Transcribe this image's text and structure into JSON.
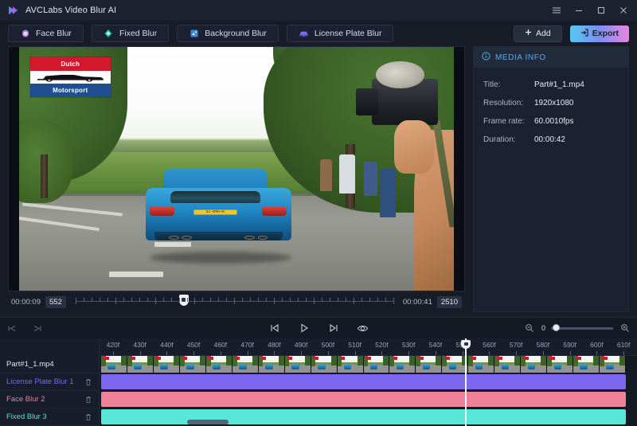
{
  "window": {
    "title": "AVCLabs Video Blur AI",
    "logo_icon": "play-chevron-logo-icon",
    "menu_icon": "hamburger-menu-icon",
    "minimize_icon": "minimize-icon",
    "maximize_icon": "maximize-icon",
    "close_icon": "close-icon"
  },
  "tabs": [
    {
      "label": "Face Blur",
      "icon": "face-blur-icon",
      "color": "#c58ae8"
    },
    {
      "label": "Fixed Blur",
      "icon": "fixed-blur-icon",
      "color": "#2fd6ac"
    },
    {
      "label": "Background Blur",
      "icon": "background-blur-icon",
      "color": "#4b9bf0"
    },
    {
      "label": "License Plate Blur",
      "icon": "license-plate-blur-icon",
      "color": "#7d6df0"
    }
  ],
  "header_buttons": {
    "add_label": "Add",
    "add_icon": "plus-icon",
    "export_label": "Export",
    "export_icon": "export-icon",
    "export_gradient_from": "#55c9f0",
    "export_gradient_to": "#e884de"
  },
  "preview": {
    "watermark": {
      "top_text": "Dutch",
      "bottom_text": "Motorsport",
      "car_icon": "race-car-silhouette-icon"
    },
    "license_plate_text": "ST-840-R"
  },
  "scrubber": {
    "start_time": "00:00:09",
    "start_frame": "552",
    "end_time": "00:00:41",
    "end_frame": "2510",
    "head_position_pct": 34
  },
  "media_info": {
    "panel_title": "MEDIA INFO",
    "panel_icon": "info-circle-icon",
    "rows": [
      {
        "label": "Title:",
        "value": "Part#1_1.mp4"
      },
      {
        "label": "Resolution:",
        "value": "1920x1080"
      },
      {
        "label": "Frame rate:",
        "value": "60.0010fps"
      },
      {
        "label": "Duration:",
        "value": "00:00:42"
      }
    ]
  },
  "timeline_toolbar": {
    "jump_start_icon": "jump-to-start-icon",
    "jump_end_icon": "jump-to-end-icon",
    "prev_frame_icon": "previous-frame-icon",
    "play_icon": "play-icon",
    "next_frame_icon": "next-frame-icon",
    "preview_icon": "eye-preview-icon",
    "zoom_out_icon": "zoom-out-icon",
    "zoom_in_icon": "zoom-in-icon",
    "zoom_value": "0"
  },
  "timeline": {
    "ruler_labels": [
      "420f",
      "430f",
      "440f",
      "450f",
      "460f",
      "470f",
      "480f",
      "490f",
      "500f",
      "510f",
      "520f",
      "530f",
      "540f",
      "550f",
      "560f",
      "570f",
      "580f",
      "590f",
      "600f",
      "610f"
    ],
    "playhead_frame": 551,
    "tracks": [
      {
        "name": "Part#1_1.mp4",
        "color": "#dfe5ee",
        "type": "video",
        "deletable": false
      },
      {
        "name": "License Plate Blur 1",
        "color": "#7b68ee",
        "clip_color": "#7b68ee",
        "type": "effect",
        "deletable": true,
        "delete_icon": "trash-icon"
      },
      {
        "name": "Face Blur 2",
        "color": "#ef7f9c",
        "clip_color": "#f08098",
        "type": "effect",
        "deletable": true,
        "delete_icon": "trash-icon"
      },
      {
        "name": "Fixed Blur 3",
        "color": "#4fe8d4",
        "clip_color": "#58e6d6",
        "type": "effect",
        "deletable": true,
        "delete_icon": "trash-icon"
      }
    ]
  }
}
